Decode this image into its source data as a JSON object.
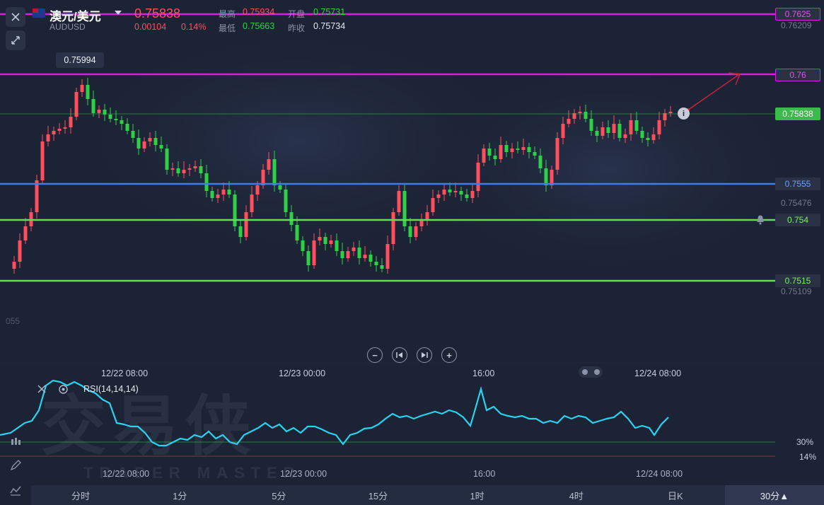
{
  "header": {
    "title": "澳元/美元",
    "symbol": "AUDUSD",
    "price": "0.75838",
    "change": "0.00104",
    "change_pct": "0.14%",
    "high_label": "最高",
    "high": "0.75934",
    "low_label": "最低",
    "low": "0.75663",
    "open_label": "开盘",
    "open": "0.75731",
    "prev_close_label": "昨收",
    "prev_close": "0.75734"
  },
  "colors": {
    "up": "#ff4f5e",
    "down": "#2ed047",
    "magenta_line": "#d81fe0",
    "blue_line": "#3d7de8",
    "green_line": "#5fe052",
    "rsi_line": "#29d3f0",
    "current_price": "#3dbb4a"
  },
  "price_axis": {
    "labels": [
      {
        "text": "0.7625",
        "kind": "magenta"
      },
      {
        "text": "0.76209",
        "kind": "plain"
      },
      {
        "text": "0.76",
        "kind": "magenta"
      },
      {
        "text": "0.75838",
        "kind": "current"
      },
      {
        "text": "0.7555",
        "kind": "blue"
      },
      {
        "text": "0.75476",
        "kind": "plain"
      },
      {
        "text": "0.754",
        "kind": "green"
      },
      {
        "text": "0.7515",
        "kind": "green"
      },
      {
        "text": "0.75109",
        "kind": "plain"
      },
      {
        "text": "055",
        "kind": "plain"
      }
    ]
  },
  "high_marker": "0.75994",
  "time_labels": [
    "12/22 08:00",
    "12/23 00:00",
    "16:00",
    "12/24 08:00"
  ],
  "rsi": {
    "label": "RSI(14,14,14)",
    "levels": [
      "30%",
      "14%"
    ]
  },
  "watermark": {
    "cn": "交易侠",
    "en": "TRADER MASTER"
  },
  "tabs": [
    "分时",
    "1分",
    "5分",
    "15分",
    "1时",
    "4时",
    "日K",
    "30分▲"
  ],
  "active_tab": "30分▲",
  "icons": [
    "close-icon",
    "collapse-arrows-icon",
    "minus-icon",
    "skip-back-icon",
    "skip-forward-icon",
    "plus-icon",
    "bell-icon",
    "pencil-icon",
    "candles-icon",
    "line-chart-icon",
    "info-icon",
    "settings-icon",
    "chevron-down-icon"
  ]
}
